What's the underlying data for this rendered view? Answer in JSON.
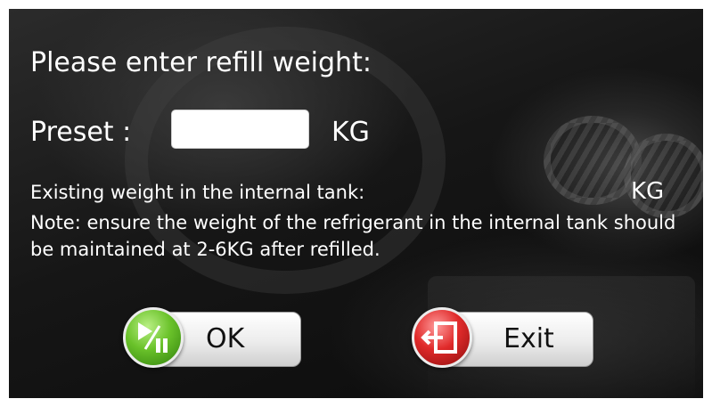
{
  "prompt": {
    "title": "Please enter refill weight:",
    "preset_label": "Preset :",
    "preset_value": "",
    "preset_unit": "KG",
    "existing_label": "Existing weight in the internal tank:",
    "existing_unit": "KG",
    "note": "Note: ensure the weight of the refrigerant in the internal tank should be maintained at 2-6KG after refilled."
  },
  "buttons": {
    "ok_label": "OK",
    "exit_label": "Exit"
  },
  "icons": {
    "ok": "play-pause-icon",
    "exit": "exit-door-icon"
  },
  "colors": {
    "ok_accent": "#5bb82a",
    "exit_accent": "#d32020",
    "text": "#ffffff"
  }
}
